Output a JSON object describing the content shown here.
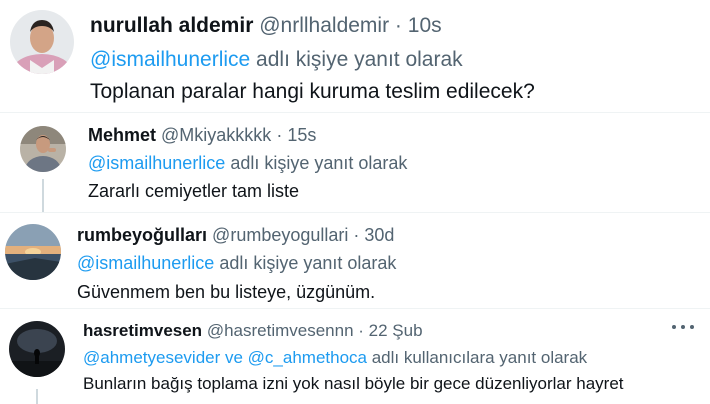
{
  "tweets": [
    {
      "name": "nurullah aldemir",
      "handle": "@nrllhaldemir",
      "sep": "·",
      "time": "10s",
      "reply_mention": "@ismailhunerlice",
      "reply_suffix": " adlı kişiye yanıt olarak",
      "text": "Toplanan paralar hangi kuruma teslim edilecek?",
      "avatar_icon": "avatar-man-suit"
    },
    {
      "name": "Mehmet",
      "handle": "@Mkiyakkkkk",
      "sep": "·",
      "time": "15s",
      "reply_mention": "@ismailhunerlice",
      "reply_suffix": " adlı kişiye yanıt olarak",
      "text": "Zararlı cemiyetler tam liste",
      "avatar_icon": "avatar-man-gym"
    },
    {
      "name": "rumbeyoğulları",
      "handle": "@rumbeyogullari",
      "sep": "·",
      "time": "30d",
      "reply_mention": "@ismailhunerlice",
      "reply_suffix": " adlı kişiye yanıt olarak",
      "text": "Güvenmem ben bu listeye, üzgünüm.",
      "avatar_icon": "avatar-sunset-sea"
    },
    {
      "name": "hasretimvesen",
      "handle": "@hasretimvesennn",
      "sep": "·",
      "time": "22 Şub",
      "reply_mention": "@ahmetyesevider ve @c_ahmethoca",
      "reply_suffix": " adlı kullanıcılara yanıt olarak",
      "text": "Bunların bağış toplama izni yok nasıl böyle bir gece düzenliyorlar hayret",
      "avatar_icon": "avatar-night-silhouette"
    }
  ],
  "colors": {
    "accent": "#1d9bf0",
    "secondary_text": "#536471",
    "primary_text": "#0f1419",
    "thread_line": "#cfd9de"
  }
}
